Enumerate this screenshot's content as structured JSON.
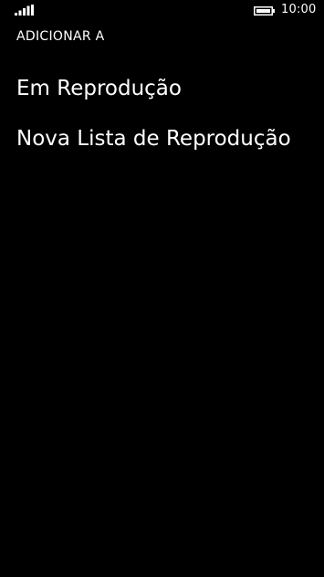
{
  "status_bar": {
    "signal_icon": "signal-strength-icon",
    "battery_icon": "battery-icon",
    "time": "10:00"
  },
  "header": {
    "title": "ADICIONAR A"
  },
  "menu": {
    "items": [
      {
        "label": "Em Reprodução"
      },
      {
        "label": "Nova Lista de Reprodução"
      }
    ]
  },
  "colors": {
    "background": "#000000",
    "foreground": "#ffffff"
  }
}
